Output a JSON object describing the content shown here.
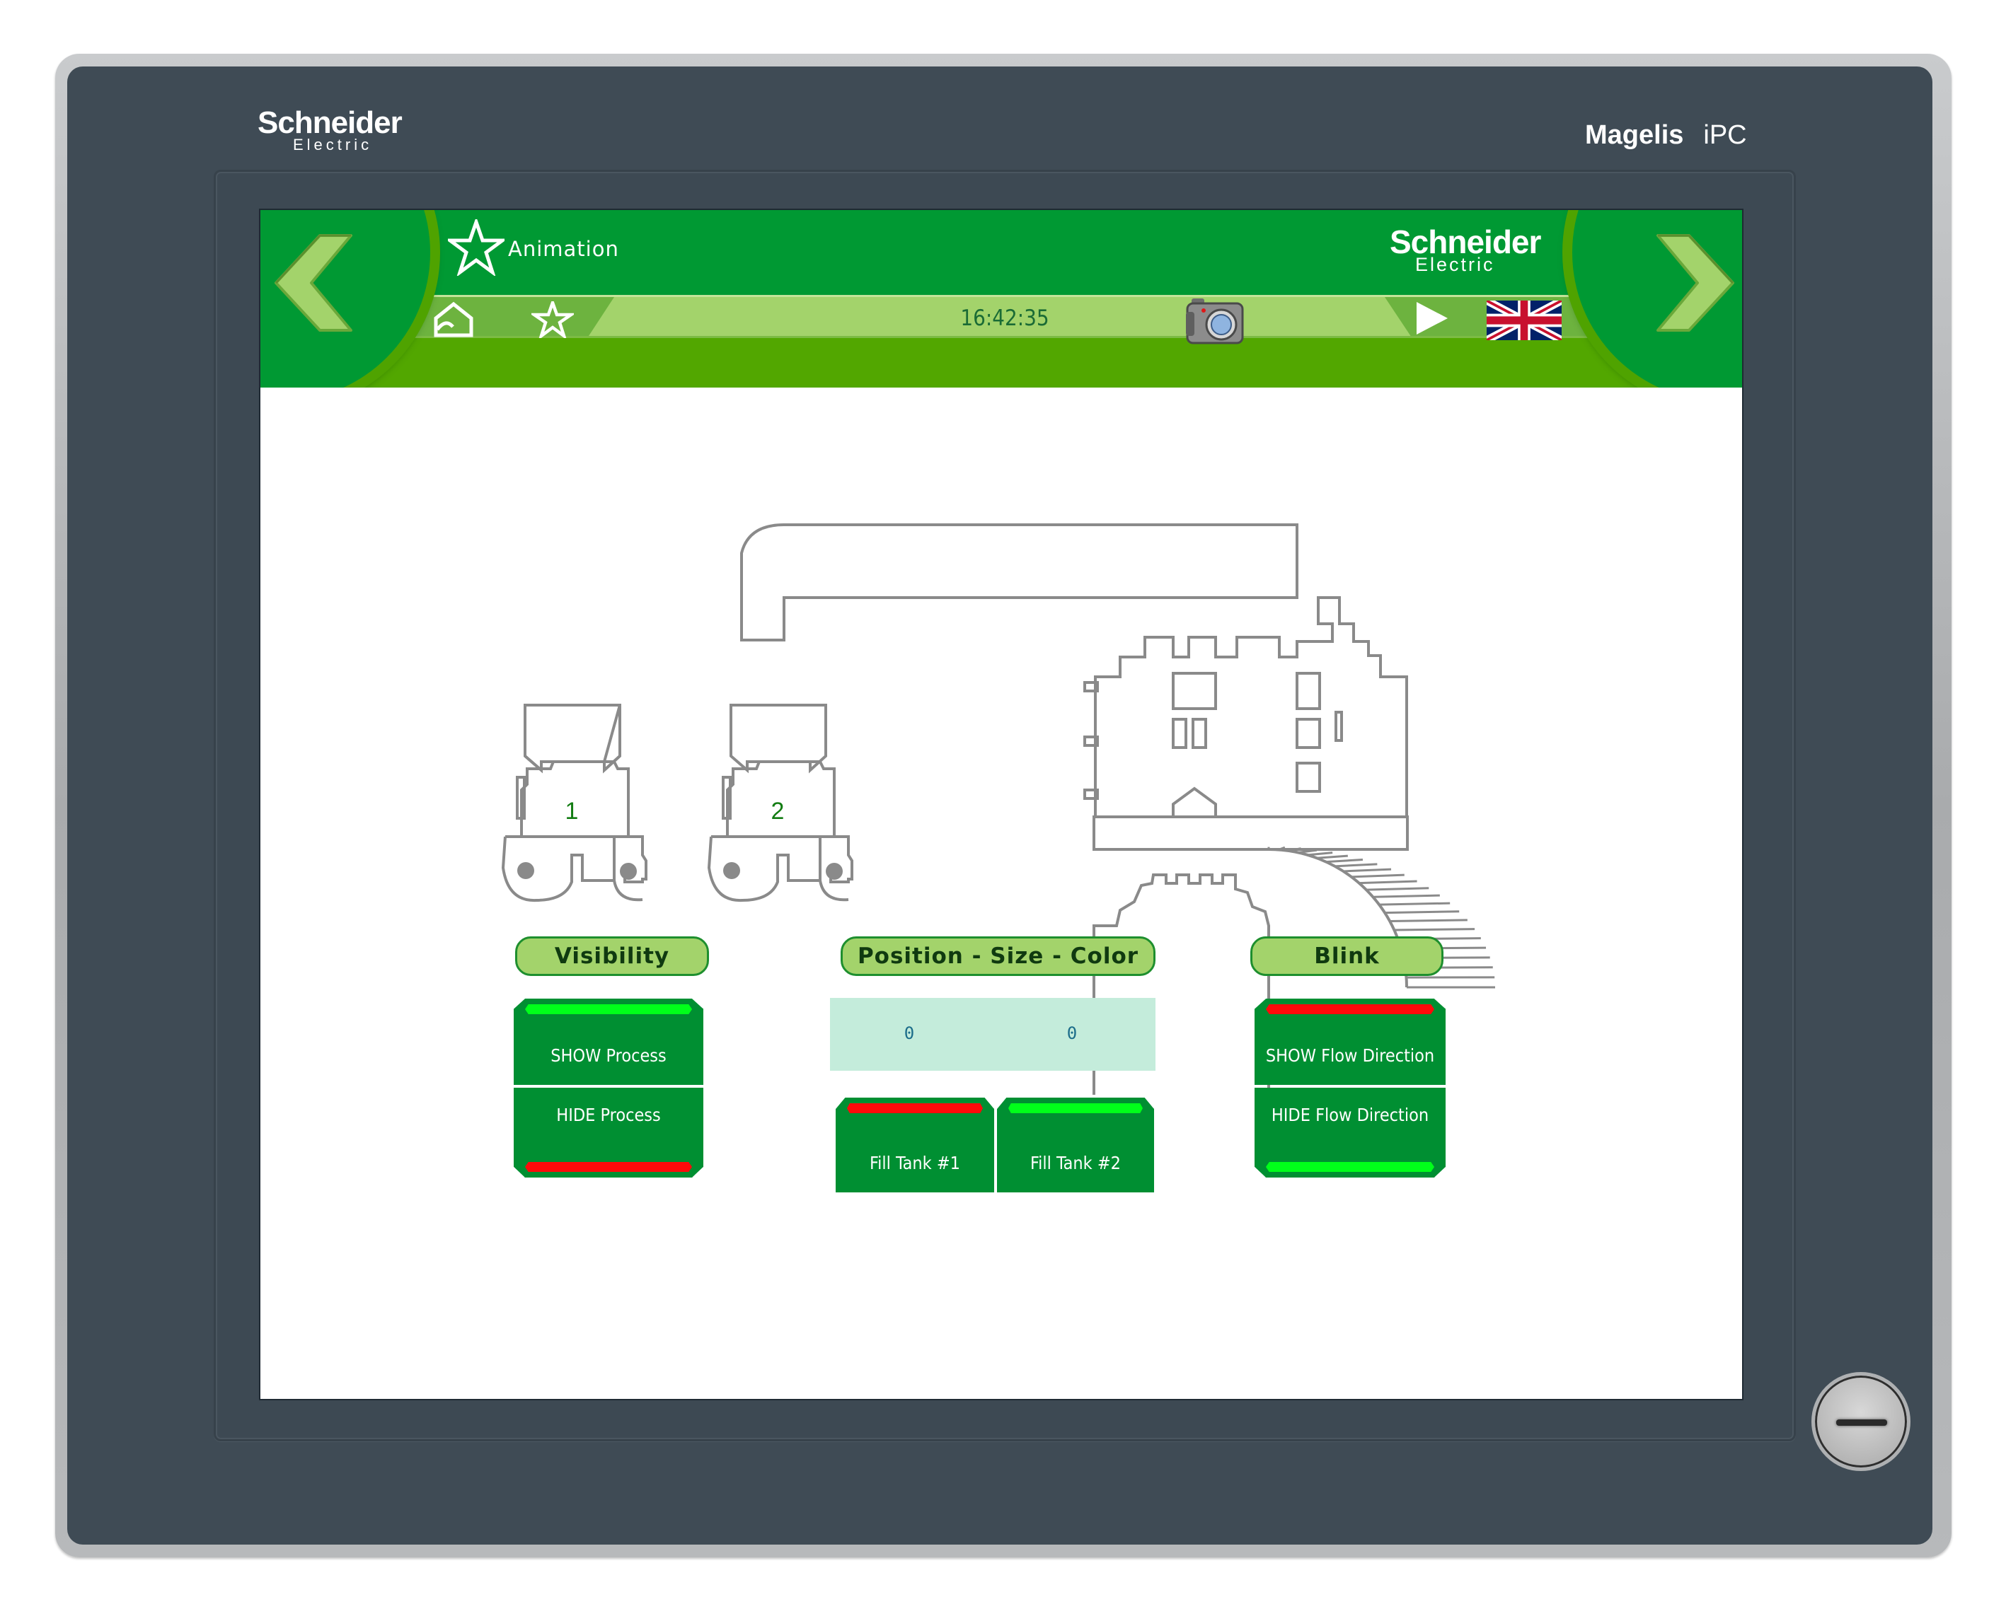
{
  "device": {
    "brand": "Schneider",
    "brand_sub": "Electric",
    "model": "Magelis",
    "model_suffix": "iPC"
  },
  "header": {
    "page_title": "Animation",
    "page_icon": "star-icon",
    "logo_main": "Schneider",
    "logo_sub": "Electric",
    "clock": "16:42:35",
    "toolbar_icons": [
      "home-icon",
      "favorite-star-icon",
      "camera-icon",
      "play-icon",
      "uk-flag-icon"
    ],
    "nav_prev_icon": "chevron-left-icon",
    "nav_next_icon": "chevron-right-icon"
  },
  "colors": {
    "header_green": "#009933",
    "header_lime": "#52a700",
    "toolbar_light": "#a3d36b",
    "button_green": "#008f32",
    "lamp_on": "#00ff1a",
    "lamp_off": "#ff0a0a",
    "value_box": "#c4ecdb",
    "bezel": "#3f4b55"
  },
  "process": {
    "tanks": [
      {
        "label": "1"
      },
      {
        "label": "2"
      }
    ]
  },
  "sections": {
    "visibility": {
      "title": "Visibility",
      "buttons": [
        {
          "label": "SHOW Process",
          "indicator": "green"
        },
        {
          "label": "HIDE Process",
          "indicator": "red"
        }
      ]
    },
    "position": {
      "title": "Position - Size - Color",
      "values": [
        "0",
        "0"
      ],
      "buttons": [
        {
          "label": "Fill Tank #1",
          "indicator": "red"
        },
        {
          "label": "Fill Tank #2",
          "indicator": "green"
        }
      ]
    },
    "blink": {
      "title": "Blink",
      "buttons": [
        {
          "label": "SHOW Flow Direction",
          "indicator": "red"
        },
        {
          "label": "HIDE Flow Direction",
          "indicator": "green"
        }
      ]
    }
  }
}
